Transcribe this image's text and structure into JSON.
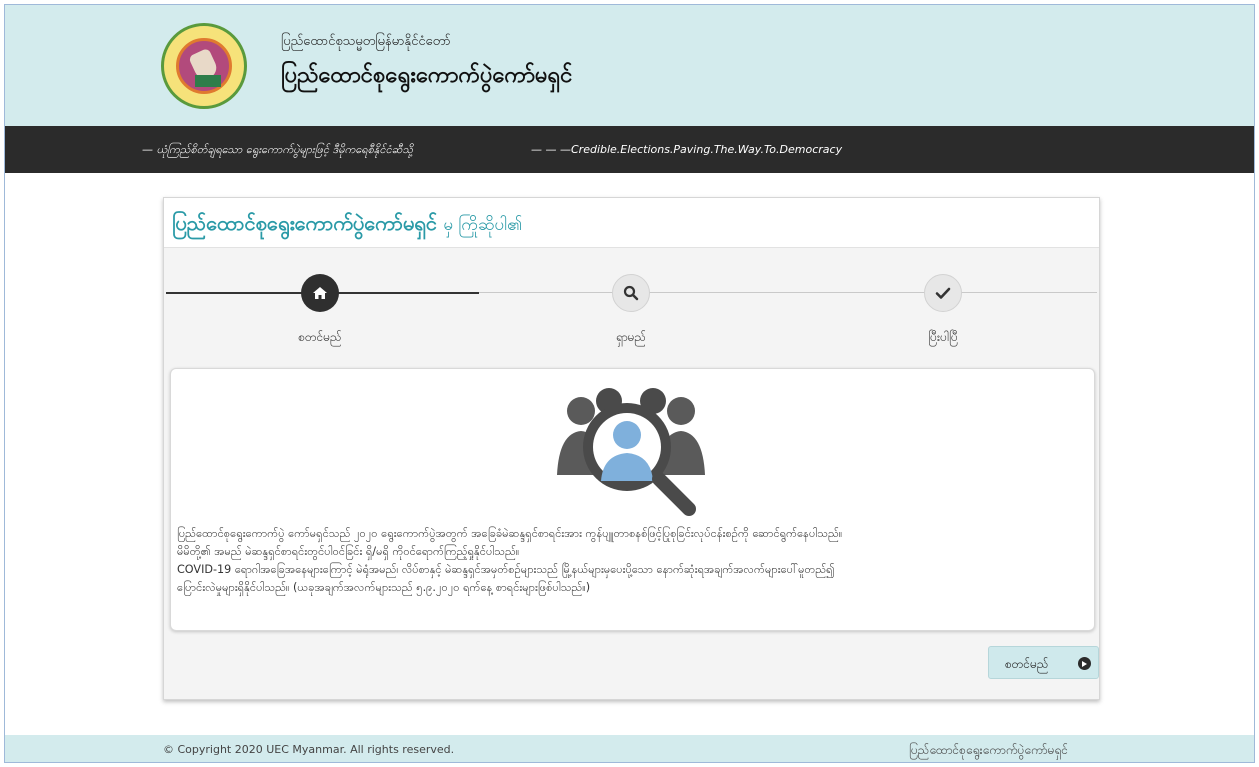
{
  "header": {
    "subtitle": "ပြည်ထောင်စုသမ္မတမြန်မာနိုင်ငံတော်",
    "title": "ပြည်ထောင်စုရွေးကောက်ပွဲကော်မရှင်"
  },
  "ticker": {
    "myanmar": "— ယုံကြည်စိတ်ချရသော ရွေးကောက်ပွဲများဖြင့် ဒီမိုကရေစီနိုင်ငံဆီသို့",
    "english": "— — —Credible.Elections.Paving.The.Way.To.Democracy"
  },
  "panel": {
    "title_org": "ပြည်ထောင်စုရွေးကောက်ပွဲကော်မရှင်",
    "title_greeting": "မှ ကြိုဆိုပါ၏",
    "steps": [
      {
        "label": "စတင်မည်",
        "icon": "home-icon",
        "state": "active"
      },
      {
        "label": "ရှာမည်",
        "icon": "search-icon",
        "state": "idle"
      },
      {
        "label": "ပြီးပါပြီ",
        "icon": "check-icon",
        "state": "idle"
      }
    ],
    "paragraphs": [
      "ပြည်ထောင်စုရွေးကောက်ပွဲ ကော်မရှင်သည် ၂၀၂၀ ရွေးကောက်ပွဲအတွက် အခြေခံမဲဆန္ဒရှင်စာရင်းအား ကွန်ပျူတာစနစ်ဖြင့်ပြုစုခြင်းလုပ်ငန်းစဉ်ကို ဆောင်ရွက်နေပါသည်။",
      "မိမိတို့၏ အမည် မဲဆန္ဒရှင်စာရင်းတွင်ပါဝင်ခြင်း ရှိ/မရှိ ကိုဝင်ရောက်ကြည့်ရှုနိုင်ပါသည်။",
      "COVID-19 ရောဂါအခြေအနေများကြောင့် မဲရုံအမည်၊ လိပ်စာနှင့် မဲဆန္ဒရှင်အမှတ်စဉ်များသည် မြို့နယ်များမှပေးပို့သော နောက်ဆုံးရအချက်အလက်များပေါ်မူတည်၍",
      "ပြောင်းလဲမှုများရှိနိုင်ပါသည်။ (ယခုအချက်အလက်များသည် ၅.၉.၂၀၂၀ ရက်နေ့ စာရင်းများဖြစ်ပါသည်။)"
    ],
    "start_button": "စတင်မည်"
  },
  "footer": {
    "copyright": "© Copyright 2020 UEC Myanmar. All rights reserved.",
    "org": "ပြည်ထောင်စုရွေးကောက်ပွဲကော်မရှင်"
  },
  "colors": {
    "header_bg": "#d3ebed",
    "ticker_bg": "#2b2b2b",
    "accent_teal": "#2a9aa7",
    "button_bg": "#cfe9ec"
  }
}
